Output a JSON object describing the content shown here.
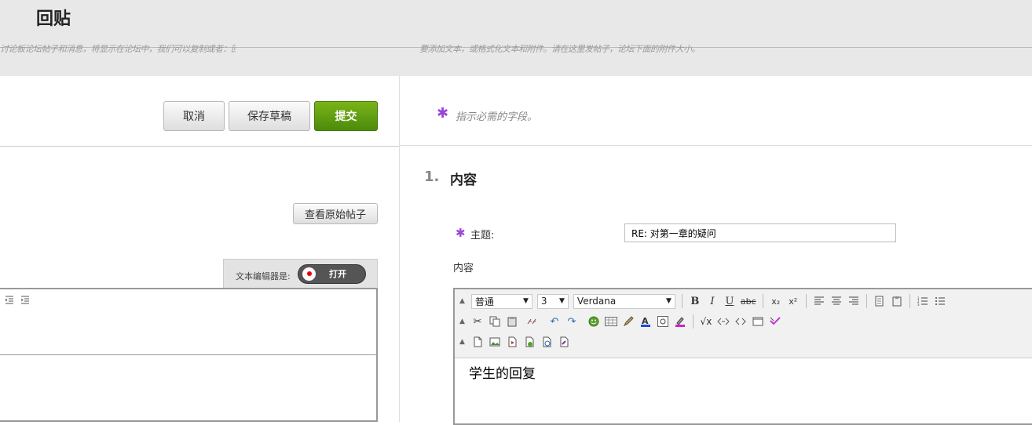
{
  "page": {
    "title": "回贴",
    "blurred_left": "讨论板论坛帖子和消息，将显示在论坛中，我们可以复制或者：回复者回复",
    "blurred_right": "要添加文本，或格式化文本和附件。请在这里发帖子，论坛下面的附件大小。"
  },
  "actions": {
    "cancel": "取消",
    "save_draft": "保存草稿",
    "submit": "提交",
    "view_original": "查看原始帖子"
  },
  "text_editor_toggle": {
    "label": "文本编辑器是:",
    "state": "打开"
  },
  "form": {
    "required_marker": "✱",
    "required_note": "指示必需的字段。",
    "section_number": "1.",
    "section_title": "内容",
    "subject_label": "主题:",
    "subject_value": "RE: 对第一章的疑问",
    "content_label": "内容"
  },
  "editor": {
    "format": "普通",
    "size": "3",
    "font": "Verdana",
    "body": "学生的回复",
    "row1_icons": [
      "bold-icon",
      "italic-icon",
      "underline-icon",
      "strikethrough-icon",
      "subscript-icon",
      "superscript-icon",
      "align-left-icon",
      "align-center-icon",
      "align-right-icon",
      "copy-text-icon",
      "paste-text-icon",
      "ordered-list-icon",
      "unordered-list-icon"
    ],
    "row2_icons": [
      "cut-icon",
      "copy-icon",
      "paste-icon",
      "unlink-icon",
      "undo-icon",
      "redo-icon",
      "emoticon-icon",
      "table-icon",
      "pencil-icon",
      "text-color-icon",
      "special-char-icon",
      "highlight-icon",
      "math-icon",
      "html-icon",
      "code-icon",
      "fullscreen-icon",
      "spellcheck-icon"
    ],
    "row3_icons": [
      "attach-file-icon",
      "insert-image-icon",
      "insert-media-icon",
      "insert-flash-icon",
      "mashup-icon",
      "insert-document-icon"
    ],
    "left_indent_icons": [
      "outdent-icon",
      "indent-icon"
    ]
  },
  "colors": {
    "submit_green": "#5a9c10",
    "required_purple": "#9b45d9",
    "header_bg": "#e8e8e8"
  }
}
